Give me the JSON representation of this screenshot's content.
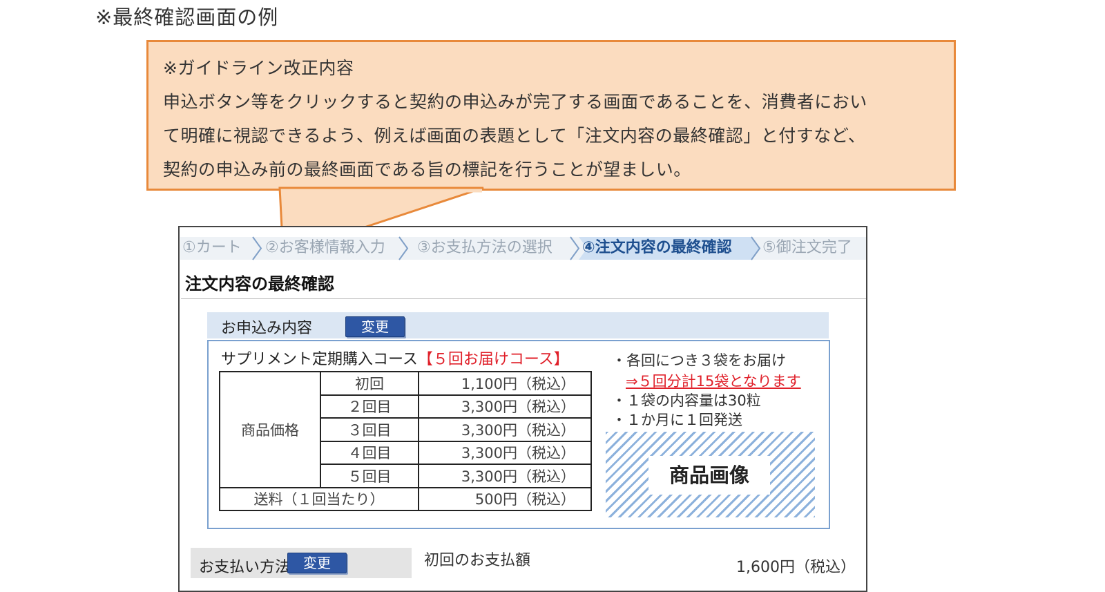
{
  "page_heading": "※最終確認画面の例",
  "callout": {
    "title": "※ガイドライン改正内容",
    "lines": [
      "申込ボタン等をクリックすると契約の申込みが完了する画面であることを、消費者におい",
      "て明確に視認できるよう、例えば画面の表題として「注文内容の最終確認」と付すなど、",
      "契約の申込み前の最終画面である旨の標記を行うことが望ましい。"
    ]
  },
  "steps": [
    {
      "label": "①カート"
    },
    {
      "label": "②お客様情報入力"
    },
    {
      "label": "③お支払方法の選択"
    },
    {
      "label": "④注文内容の最終確認"
    },
    {
      "label": "⑤御注文完了"
    }
  ],
  "confirm_title": "注文内容の最終確認",
  "order_section": {
    "label": "お申込み内容",
    "change_label": "変更",
    "product_name": "サプリメント定期購入コース",
    "course": "【５回お届けコース】",
    "price_label": "商品価格",
    "rounds": [
      {
        "round": "初回",
        "amount": "1,100円（税込）"
      },
      {
        "round": "２回目",
        "amount": "3,300円（税込）"
      },
      {
        "round": "３回目",
        "amount": "3,300円（税込）"
      },
      {
        "round": "４回目",
        "amount": "3,300円（税込）"
      },
      {
        "round": "５回目",
        "amount": "3,300円（税込）"
      }
    ],
    "shipping_label": "送料（１回当たり）",
    "shipping_amount": "500円（税込）",
    "notes": {
      "n1": "・各回につき３袋をお届け",
      "n1_emph": "⇒５回分計15袋となります",
      "n2": "・１袋の内容量は30粒",
      "n3": "・１か月に１回発送"
    },
    "image_label": "商品画像"
  },
  "payment_section": {
    "label": "お支払い方法",
    "change_label": "変更",
    "first_payment_label": "初回のお支払額",
    "first_payment_amount": "1,600円（税込）"
  },
  "colors": {
    "callout_fill": "#fbdcbf",
    "callout_border": "#e8893a",
    "highlight_red": "#e0202a",
    "button_blue": "#2e57a4",
    "active_step": "#1e4f8f"
  }
}
